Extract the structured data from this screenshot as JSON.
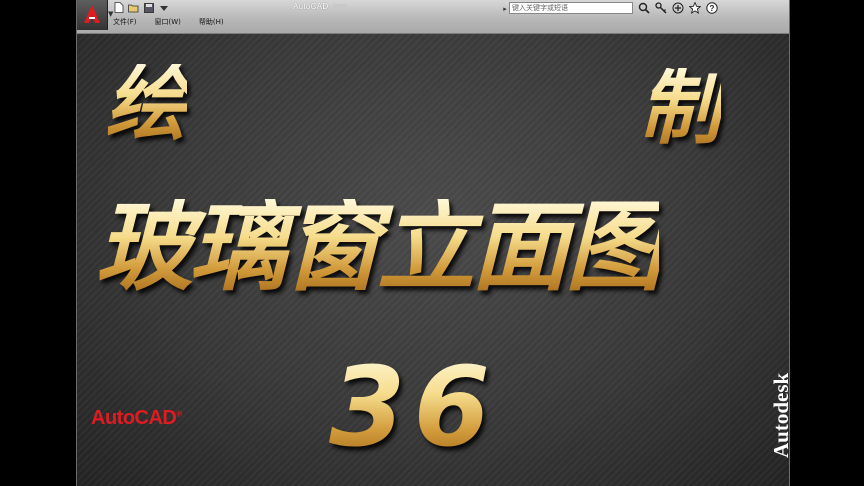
{
  "window": {
    "title": "AutoCAD"
  },
  "menu": {
    "items": [
      "文件(F)",
      "窗口(W)",
      "帮助(H)"
    ]
  },
  "search": {
    "placeholder": "键入关键字或短语"
  },
  "toolbar_icons": [
    "search-icon",
    "key-icon",
    "connect-icon",
    "star-icon",
    "help-icon"
  ],
  "quick_access_icons": [
    "new-file-icon",
    "open-folder-icon",
    "save-icon",
    "dropdown-arrow-icon"
  ],
  "canvas": {
    "title_char_1": "绘",
    "title_char_2": "制",
    "main_title": "玻璃窗立面图",
    "episode": "36",
    "logo_left": "AutoCAD",
    "logo_left_mark": "®",
    "logo_right": "Autodesk"
  },
  "colors": {
    "logo_red": "#e01b22",
    "gold": "#f6dc8c",
    "background": "#383838"
  }
}
